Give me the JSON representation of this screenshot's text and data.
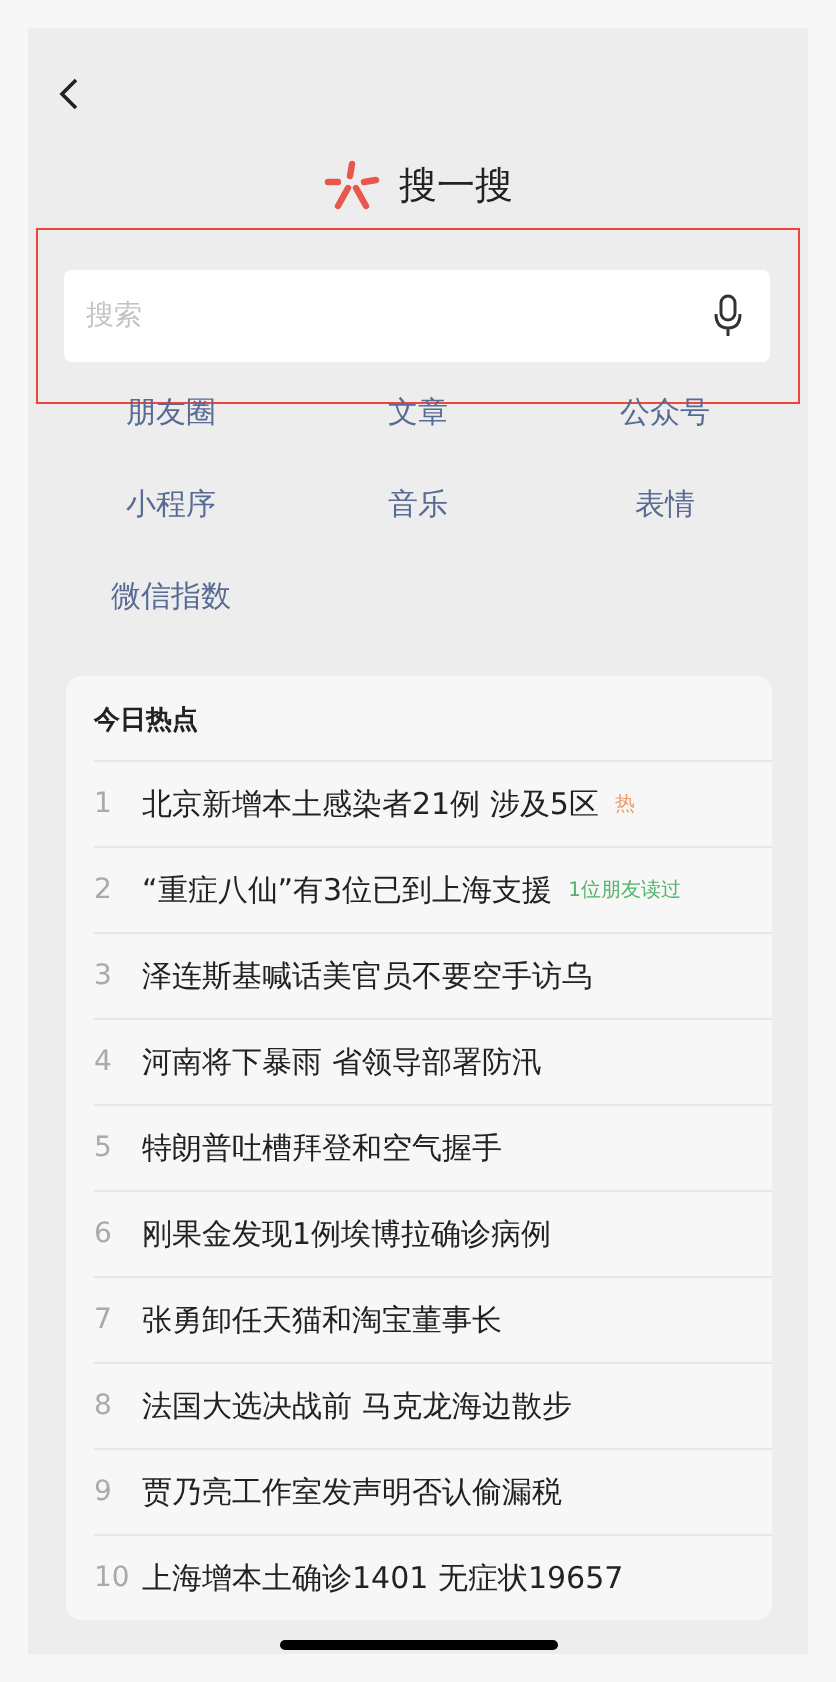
{
  "title": "搜一搜",
  "search": {
    "placeholder": "搜索"
  },
  "categories": [
    "朋友圈",
    "文章",
    "公众号",
    "小程序",
    "音乐",
    "表情",
    "微信指数"
  ],
  "hot": {
    "heading": "今日热点",
    "items": [
      {
        "rank": "1",
        "title": "北京新增本土感染者21例 涉及5区",
        "tag": {
          "kind": "hot",
          "text": "热"
        }
      },
      {
        "rank": "2",
        "title": "“重症八仙”有3位已到上海支援",
        "tag": {
          "kind": "friends",
          "text": "1位朋友读过"
        }
      },
      {
        "rank": "3",
        "title": "泽连斯基喊话美官员不要空手访乌"
      },
      {
        "rank": "4",
        "title": "河南将下暴雨 省领导部署防汛"
      },
      {
        "rank": "5",
        "title": "特朗普吐槽拜登和空气握手"
      },
      {
        "rank": "6",
        "title": "刚果金发现1例埃博拉确诊病例"
      },
      {
        "rank": "7",
        "title": "张勇卸任天猫和淘宝董事长"
      },
      {
        "rank": "8",
        "title": "法国大选决战前 马克龙海边散步"
      },
      {
        "rank": "9",
        "title": "贾乃亮工作室发声明否认偷漏税"
      },
      {
        "rank": "10",
        "title": "上海增本土确诊1401 无症状19657"
      }
    ]
  }
}
